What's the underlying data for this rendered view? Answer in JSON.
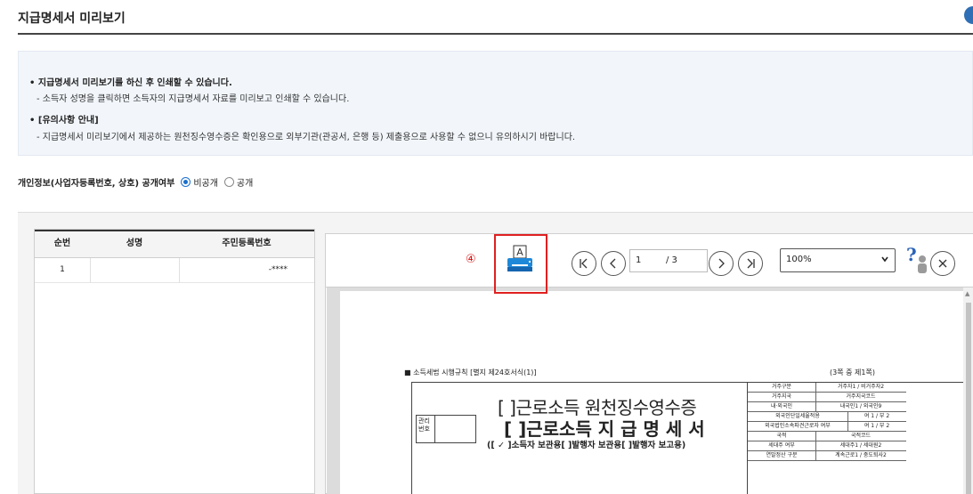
{
  "page": {
    "title": "지급명세서 미리보기"
  },
  "notice": {
    "line1": "• 지급명세서 미리보기를 하신 후 인쇄할 수 있습니다.",
    "line2": "- 소득자 성명을 클릭하면 소득자의 지급명세서 자료를 미리보고 인쇄할 수 있습니다.",
    "line3": "• [유의사항 안내]",
    "line4": "- 지급명세서 미리보기에서 제공하는 원천징수영수증은 확인용으로 외부기관(관공서, 은행 등) 제출용으로 사용할 수 없으니 유의하시기 바랍니다."
  },
  "privacy": {
    "label": "개인정보(사업자등록번호, 상호) 공개여부",
    "options": [
      "비공개",
      "공개"
    ],
    "selected": "비공개"
  },
  "table": {
    "headers": [
      "순번",
      "성명",
      "주민등록번호"
    ],
    "rows": [
      {
        "no": "1",
        "name": "",
        "rrn": "-****"
      }
    ]
  },
  "viewer": {
    "step_marker": "④",
    "print_icon": "printer-icon",
    "current_page": "1",
    "total_pages": "/ 3",
    "zoom": "100%",
    "help": "?",
    "close_icon": "close-icon"
  },
  "document": {
    "header_left": "■ 소득세법 시행규칙 [별지 제24호서식(1)]",
    "header_right": "(3쪽 중 제1쪽)",
    "mgmt_label": "관리 번호",
    "title1": "[ ]근로소득 원천징수영수증",
    "title2": "[ ]근로소득 지 급 명 세 서",
    "subtitle": "([ ✓ ]소득자 보관용[    ]발행자 보관용[    ]발행자 보고용)",
    "grid": [
      [
        "거주구분",
        "거주자1 / 비거주자2"
      ],
      [
        "거주지국",
        "거주지국코드"
      ],
      [
        "내·외국인",
        "내국인1 / 외국인9"
      ],
      [
        "외국인단일세율적용",
        "여 1 / 부 2"
      ],
      [
        "외국법인소속파견근로자 여부",
        "여 1 / 부 2"
      ],
      [
        "국적",
        "국적코드"
      ],
      [
        "세대주 여부",
        "세대주1 / 세대원2"
      ],
      [
        "연말정산 구분",
        "계속근로1 / 중도퇴사2"
      ]
    ]
  },
  "colors": {
    "accent": "#2f6fb5",
    "highlight": "#e02020",
    "notice_bg": "#f2f6fb"
  }
}
